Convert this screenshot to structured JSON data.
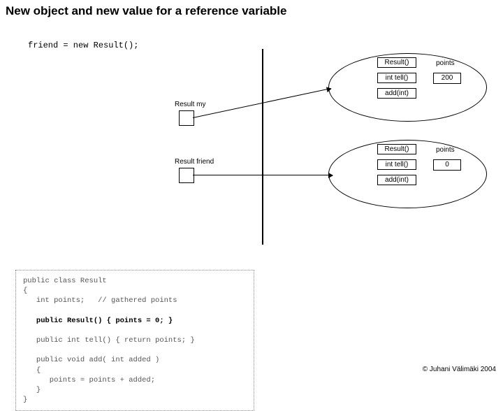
{
  "title": "New object and new value for a reference variable",
  "statement": "friend = new Result();",
  "object1": {
    "m1": "Result()",
    "m2": "int tell()",
    "m3": "add(int)",
    "field_label": "points",
    "field_value": "200"
  },
  "object2": {
    "m1": "Result()",
    "m2": "int tell()",
    "m3": "add(int)",
    "field_label": "points",
    "field_value": "0"
  },
  "var1": {
    "label": "Result my"
  },
  "var2": {
    "label": "Result friend"
  },
  "code": {
    "l1": "public class Result",
    "l2": "{",
    "l3": "   int points;   // gathered points",
    "l4": "",
    "l5": "   public Result() { points = 0; }",
    "l6": "",
    "l7": "   public int tell() { return points; }",
    "l8": "",
    "l9": "   public void add( int added )",
    "l10": "   {",
    "l11": "      points = points + added;",
    "l12": "   }",
    "l13": "}"
  },
  "copyright": "© Juhani Välimäki 2004"
}
